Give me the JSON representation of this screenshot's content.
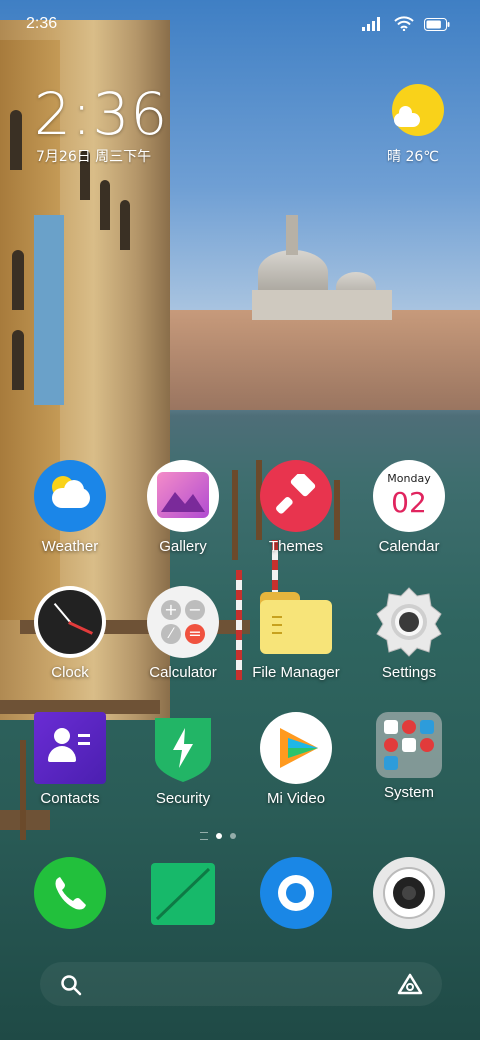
{
  "status_bar": {
    "time": "2:36",
    "battery_level": 0.8
  },
  "clock_widget": {
    "time": "2:36",
    "date": "7月26日 周三下午"
  },
  "weather_widget": {
    "icon": "sun-cloud-icon",
    "text": "晴 26℃"
  },
  "apps": [
    {
      "label": "Weather",
      "icon": "weather-icon"
    },
    {
      "label": "Gallery",
      "icon": "gallery-icon"
    },
    {
      "label": "Themes",
      "icon": "themes-icon"
    },
    {
      "label": "Calendar",
      "icon": "calendar-icon",
      "calendar_day": "Monday",
      "calendar_date": "02"
    },
    {
      "label": "Clock",
      "icon": "clock-icon"
    },
    {
      "label": "Calculator",
      "icon": "calculator-icon"
    },
    {
      "label": "File Manager",
      "icon": "file-manager-icon"
    },
    {
      "label": "Settings",
      "icon": "settings-icon"
    },
    {
      "label": "Contacts",
      "icon": "contacts-icon"
    },
    {
      "label": "Security",
      "icon": "security-icon"
    },
    {
      "label": "Mi Video",
      "icon": "mi-video-icon"
    },
    {
      "label": "System",
      "icon": "system-folder-icon"
    }
  ],
  "page_indicator": {
    "pages": 2,
    "current": 1
  },
  "dock": [
    {
      "icon": "phone-icon"
    },
    {
      "icon": "messages-icon"
    },
    {
      "icon": "browser-icon"
    },
    {
      "icon": "camera-icon"
    }
  ],
  "search_bar": {
    "left_icon": "search-icon",
    "right_icon": "assistant-icon"
  },
  "colors": {
    "calendar_date": "#e0245e",
    "themes_bg": "#e8344e",
    "weather_bg": "#1b86e8",
    "dock_phone": "#22c03c"
  }
}
